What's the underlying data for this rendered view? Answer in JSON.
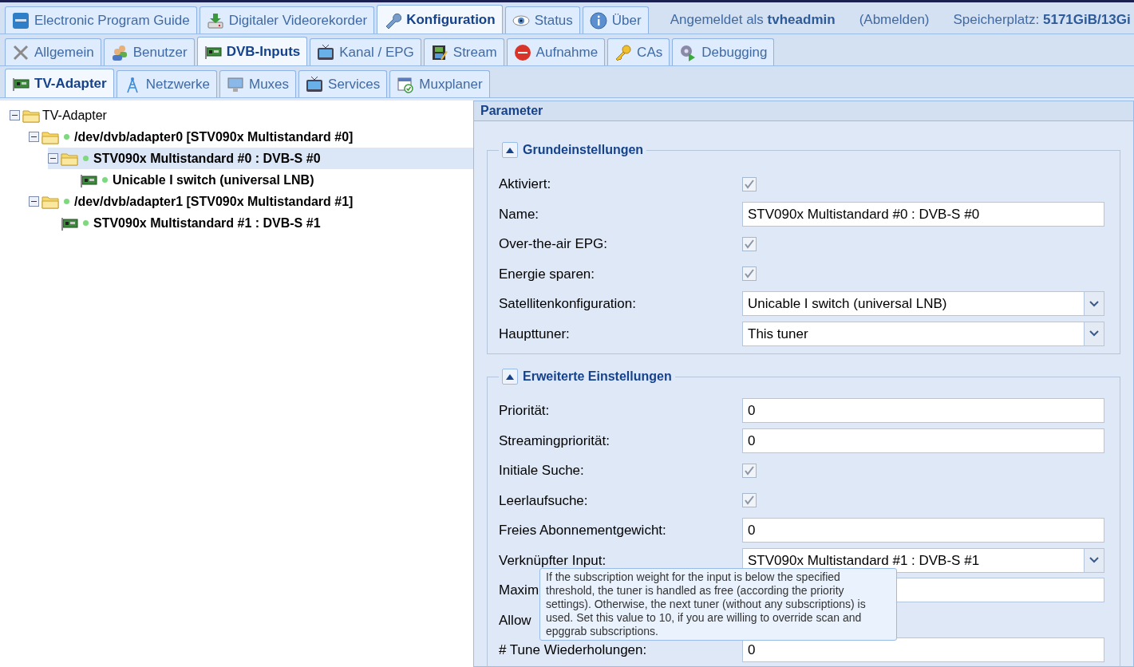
{
  "top_tabs": [
    {
      "label": "Electronic Program Guide",
      "selected": false
    },
    {
      "label": "Digitaler Videorekorder",
      "selected": false
    },
    {
      "label": "Konfiguration",
      "selected": true
    },
    {
      "label": "Status",
      "selected": false
    },
    {
      "label": "Über",
      "selected": false
    }
  ],
  "session": {
    "prefix": "Angemeldet als",
    "user": "tvheadmin",
    "logout": "(Abmelden)",
    "storage_label": "Speicherplatz:",
    "storage_value": "5171GiB/13Gi"
  },
  "config_tabs": [
    {
      "label": "Allgemein",
      "selected": false
    },
    {
      "label": "Benutzer",
      "selected": false
    },
    {
      "label": "DVB-Inputs",
      "selected": true
    },
    {
      "label": "Kanal / EPG",
      "selected": false
    },
    {
      "label": "Stream",
      "selected": false
    },
    {
      "label": "Aufnahme",
      "selected": false
    },
    {
      "label": "CAs",
      "selected": false
    },
    {
      "label": "Debugging",
      "selected": false
    }
  ],
  "dvb_tabs": [
    {
      "label": "TV-Adapter",
      "selected": true
    },
    {
      "label": "Netzwerke",
      "selected": false
    },
    {
      "label": "Muxes",
      "selected": false
    },
    {
      "label": "Services",
      "selected": false
    },
    {
      "label": "Muxplaner",
      "selected": false
    }
  ],
  "tree": [
    {
      "label": "TV-Adapter",
      "kind": "folder",
      "expanded": true,
      "selected": false,
      "children": [
        {
          "label": "/dev/dvb/adapter0 [STV090x Multistandard #0]",
          "kind": "folder",
          "status": true,
          "expanded": true,
          "selected": false,
          "children": [
            {
              "label": "STV090x Multistandard #0 : DVB-S #0",
              "kind": "folder",
              "status": true,
              "expanded": true,
              "selected": true,
              "children": [
                {
                  "label": "Unicable I switch (universal LNB)",
                  "kind": "card",
                  "status": true,
                  "selected": false
                }
              ]
            }
          ]
        },
        {
          "label": "/dev/dvb/adapter1 [STV090x Multistandard #1]",
          "kind": "folder",
          "status": true,
          "expanded": true,
          "selected": false,
          "children": [
            {
              "label": "STV090x Multistandard #1 : DVB-S #1",
              "kind": "card",
              "status": true,
              "selected": false
            }
          ]
        }
      ]
    }
  ],
  "panel": {
    "title": "Parameter",
    "fieldsets": [
      {
        "title": "Grundeinstellungen",
        "expanded": true,
        "fields": [
          {
            "label": "Aktiviert:",
            "kind": "checkbox",
            "checked": true
          },
          {
            "label": "Name:",
            "kind": "text",
            "value": "STV090x Multistandard #0 : DVB-S #0"
          },
          {
            "label": "Over-the-air EPG:",
            "kind": "checkbox",
            "checked": true
          },
          {
            "label": "Energie sparen:",
            "kind": "checkbox",
            "checked": true
          },
          {
            "label": "Satellitenkonfiguration:",
            "kind": "select",
            "value": "Unicable I switch (universal LNB)"
          },
          {
            "label": "Haupttuner:",
            "kind": "select",
            "value": "This tuner"
          }
        ]
      },
      {
        "title": "Erweiterte Einstellungen",
        "expanded": true,
        "fields": [
          {
            "label": "Priorität:",
            "kind": "text",
            "value": "0"
          },
          {
            "label": "Streamingpriorität:",
            "kind": "text",
            "value": "0"
          },
          {
            "label": "Initiale Suche:",
            "kind": "checkbox",
            "checked": true
          },
          {
            "label": "Leerlaufsuche:",
            "kind": "checkbox",
            "checked": true
          },
          {
            "label": "Freies Abonnementgewicht:",
            "kind": "text",
            "value": "0"
          },
          {
            "label": "Verknüpfter Input:",
            "kind": "select",
            "value": "STV090x Multistandard #1 : DVB-S #1"
          },
          {
            "label": "Maxim",
            "kind": "text"
          },
          {
            "label": "Allow",
            "kind": "covered"
          },
          {
            "label": "# Tune Wiederholungen:",
            "kind": "text",
            "value": "0"
          }
        ]
      }
    ]
  },
  "tooltip": "If the subscription weight for the input is below the specified threshold, the tuner is handled as free (according the priority settings). Otherwise, the next tuner (without any subscriptions) is used. Set this value to 10, if you are willing to override scan and epggrab subscriptions."
}
